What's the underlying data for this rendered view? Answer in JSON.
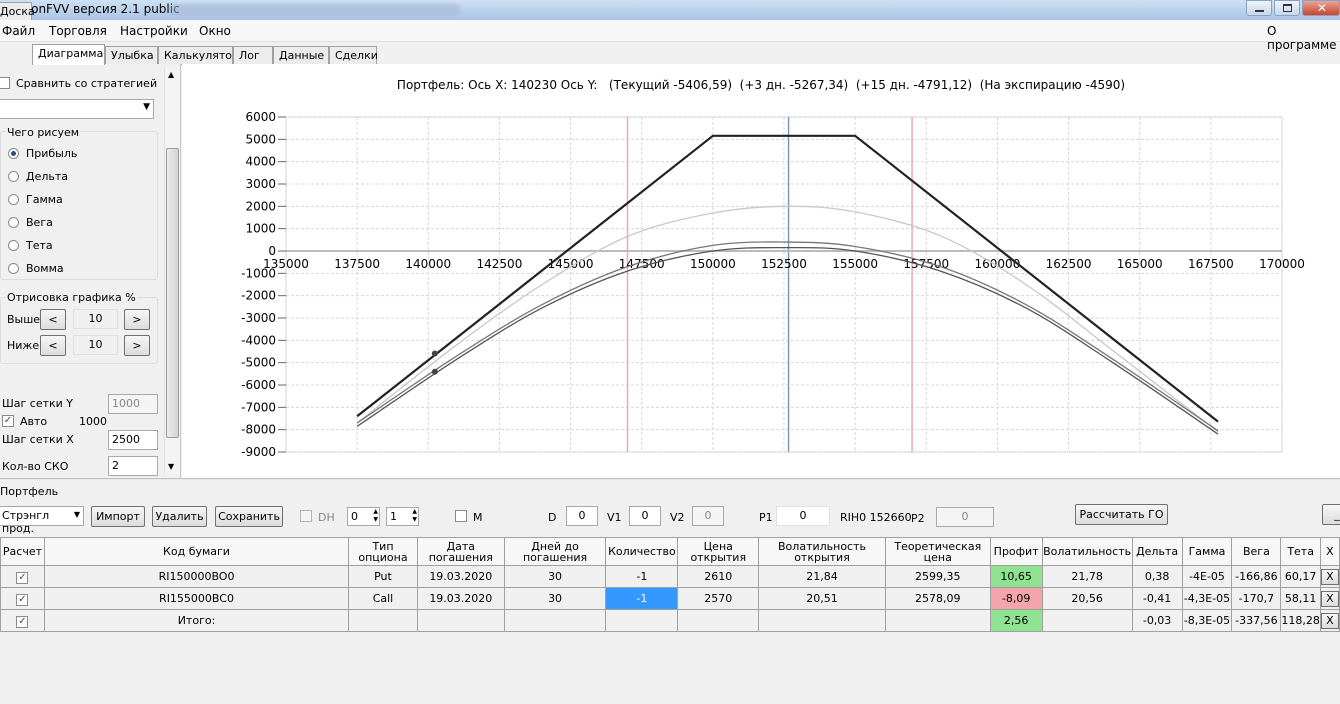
{
  "window": {
    "title": "OptionFVV версия 2.1 public"
  },
  "menu": {
    "items": [
      "Файл",
      "Торговля",
      "Настройки",
      "Окно"
    ],
    "about": "О программе"
  },
  "tabs": [
    "Доска",
    "Диаграмма",
    "Улыбка",
    "Калькулятор",
    "Лог",
    "Данные",
    "Сделки"
  ],
  "left": {
    "compare_label": "Сравнить со стратегией",
    "draw_what_title": "Чего рисуем",
    "radios": [
      "Прибыль",
      "Дельта",
      "Гамма",
      "Вега",
      "Тета",
      "Вомма"
    ],
    "selected_radio": "Прибыль",
    "draw_pct_title": "Отрисовка графика %",
    "above_label": "Выше",
    "above_value": "10",
    "below_label": "Ниже",
    "below_value": "10",
    "prev": "<",
    "next": ">",
    "grid_y_label": "Шаг сетки Y",
    "grid_y_value": "1000",
    "auto_label": "Авто",
    "auto_value": "1000",
    "grid_x_label": "Шаг сетки X",
    "grid_x_value": "2500",
    "sko_label": "Кол-во СКО",
    "sko_value": "2"
  },
  "chart_header": "Портфель: Ось X: 140230 Ось Y:   (Текущий -5406,59)  (+3 дн. -5267,34)  (+15 дн. -4791,12)  (На экспирацию -4590)",
  "chart_data": {
    "type": "line",
    "xlim": [
      135000,
      170000
    ],
    "ylim": [
      -9000,
      6000
    ],
    "xticks": [
      135000,
      137500,
      140000,
      142500,
      145000,
      147500,
      150000,
      152500,
      155000,
      157500,
      160000,
      162500,
      165000,
      167500,
      170000
    ],
    "yticks": [
      6000,
      5000,
      4000,
      3000,
      2000,
      1000,
      0,
      -1000,
      -2000,
      -3000,
      -4000,
      -5000,
      -6000,
      -7000,
      -8000,
      -9000
    ],
    "grid": true,
    "series": [
      {
        "color": "#222222",
        "x": [
          137500,
          150000,
          155000,
          167750
        ],
        "y": [
          -7400,
          5160,
          5160,
          -7640
        ]
      },
      {
        "color": "#c8c8c8",
        "x": [
          137500,
          141000,
          144000,
          147000,
          150000,
          152600,
          155000,
          158000,
          161000,
          164000,
          167750
        ],
        "y": [
          -7700,
          -4200,
          -1500,
          650,
          1700,
          2000,
          1750,
          680,
          -1500,
          -4400,
          -8100
        ]
      },
      {
        "color": "#777777",
        "x": [
          137500,
          141000,
          144000,
          147000,
          150000,
          152600,
          155000,
          158000,
          161000,
          164000,
          167750
        ],
        "y": [
          -7700,
          -4700,
          -2400,
          -700,
          250,
          400,
          200,
          -700,
          -2400,
          -4800,
          -8050
        ]
      },
      {
        "color": "#555555",
        "x": [
          137500,
          141000,
          144000,
          147000,
          150000,
          152600,
          155000,
          158000,
          161000,
          164000,
          167750
        ],
        "y": [
          -7850,
          -4850,
          -2550,
          -900,
          0,
          150,
          0,
          -900,
          -2550,
          -4950,
          -8200
        ]
      }
    ],
    "markers": [
      {
        "x": 140230,
        "y": -4590
      },
      {
        "x": 140230,
        "y": -5406
      }
    ],
    "vlines": [
      {
        "x": 147000,
        "color": "#f4a6b4"
      },
      {
        "x": 152660,
        "color": "#7f98b5"
      },
      {
        "x": 157000,
        "color": "#f4a6b4"
      }
    ]
  },
  "portfolio": {
    "title": "Портфель",
    "strategy": "Стрэнгл прод.",
    "import": "Импорт",
    "delete": "Удалить",
    "save": "Сохранить",
    "dh_label": "DH",
    "spin1": "0",
    "spin2": "1",
    "m_label": "M",
    "d_label": "D",
    "d_value": "0",
    "v1_label": "V1",
    "v1_value": "0",
    "v2_label": "V2",
    "v2_value": "0",
    "p1_label": "P1",
    "p1_value": "0",
    "rih_label": "RIH0 152660",
    "p2_label": "P2",
    "p2_value": "0",
    "calc_go": "Рассчитать ГО",
    "extra_btn": "_"
  },
  "table": {
    "headers": [
      "Расчет",
      "Код бумаги",
      "Тип\nопциона",
      "Дата\nпогашения",
      "Дней до\nпогашения",
      "Количество",
      "Цена\nоткрытия",
      "Волатильность\nоткрытия",
      "Теоретическая\nцена",
      "Профит",
      "Волатильность",
      "Дельта",
      "Гамма",
      "Вега",
      "Тета",
      "X"
    ],
    "rows": [
      [
        "✓",
        "RI150000BO0",
        "Put",
        "19.03.2020",
        "30",
        "-1",
        "2610",
        "21,84",
        "2599,35",
        "10,65",
        "21,78",
        "0,38",
        "-4E-05",
        "-166,86",
        "60,17",
        "X"
      ],
      [
        "✓",
        "RI155000BC0",
        "Call",
        "19.03.2020",
        "30",
        "-1",
        "2570",
        "20,51",
        "2578,09",
        "-8,09",
        "20,56",
        "-0,41",
        "-4,3E-05",
        "-170,7",
        "58,11",
        "X"
      ],
      [
        "✓",
        "Итого:",
        "",
        "",
        "",
        "",
        "",
        "",
        "",
        "2,56",
        "",
        "-0,03",
        "-8,3E-05",
        "-337,56",
        "118,28",
        "X"
      ]
    ],
    "profit_colors": [
      "#8fe28f",
      "#f2a5ab",
      "#8fe28f"
    ]
  }
}
